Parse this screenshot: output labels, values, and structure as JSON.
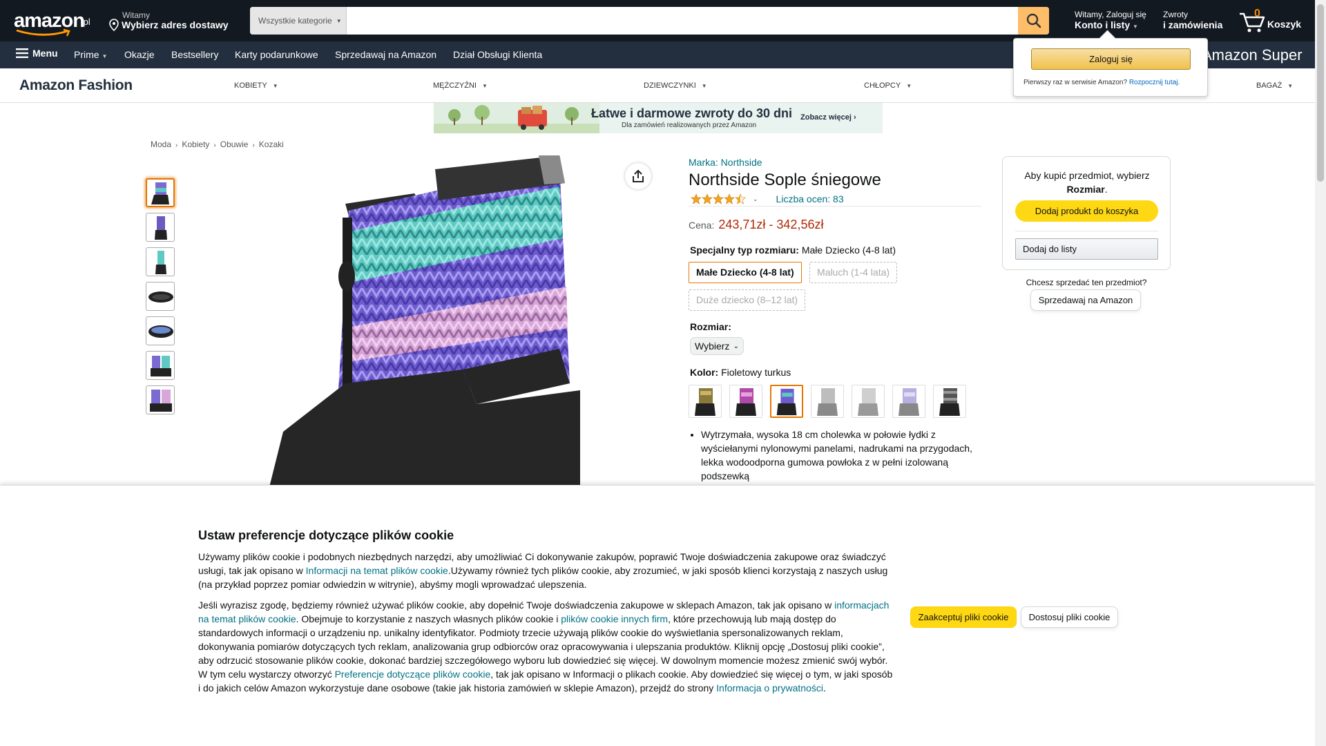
{
  "nav": {
    "logo_text": "amazon",
    "logo_tld": ".pl",
    "deliver_line1": "Witamy",
    "deliver_line2": "Wybierz adres dostawy",
    "search_category": "Wszystkie kategorie",
    "search_placeholder": "",
    "account_line1": "Witamy, Zaloguj się",
    "account_line2": "Konto i listy",
    "orders_line1": "Zwroty",
    "orders_line2": "i zamówienia",
    "cart_count": "0",
    "cart_label": "Koszyk",
    "accent_color": "#febd69"
  },
  "mainnav": {
    "menu": "Menu",
    "items": [
      "Prime",
      "Okazje",
      "Bestsellery",
      "Karty podarunkowe",
      "Sprzedawaj na Amazon",
      "Dział Obsługi Klienta"
    ],
    "promo": "Amazon Super"
  },
  "fashion": {
    "brand": "Amazon Fashion",
    "categories": [
      "KOBIETY",
      "MĘŻCZYŹNI",
      "DZIEWCZYNKI",
      "CHŁOPCY",
      "BAGAŻ"
    ]
  },
  "flyout": {
    "signin": "Zaloguj się",
    "new_customer": "Pierwszy raz w serwisie Amazon?",
    "start_link": "Rozpocznij tutaj."
  },
  "banner": {
    "title": "Łatwe i darmowe zwroty do 30 dni",
    "subtitle": "Dla zamówień realizowanych przez Amazon",
    "more": "Zobacz więcej ›"
  },
  "breadcrumb": [
    "Moda",
    "Kobiety",
    "Obuwie",
    "Kozaki"
  ],
  "product": {
    "brand": "Marka: Northside",
    "title": "Northside Sople śniegowe",
    "rating_stars": 4.5,
    "rating_count": "Liczba ocen: 83",
    "price_label": "Cena:",
    "price": "243,71zł - 342,56zł",
    "size_type_label": "Specjalny typ rozmiaru:",
    "size_type_value": "Małe Dziecko (4-8 lat)",
    "size_types": [
      {
        "label": "Małe Dziecko (4-8 lat)",
        "state": "selected"
      },
      {
        "label": "Maluch (1-4 lata)",
        "state": "unavailable"
      },
      {
        "label": "Duże dziecko (8–12 lat)",
        "state": "unavailable"
      }
    ],
    "size_label": "Rozmiar:",
    "size_select": "Wybierz",
    "color_label": "Kolor:",
    "color_value": "Fioletowy turkus",
    "swatch_count_selected_index": 2,
    "bullet1": "Wytrzymała, wysoka 18 cm cholewka w połowie łydki z wyściełanymi nylonowymi panelami, nadrukami na przygodach, lekka wodoodporna gumowa powłoka z w pełni izolowaną podszewką"
  },
  "buybox": {
    "msg_line1": "Aby kupić przedmiot, wybierz",
    "msg_bold": "Rozmiar",
    "msg_end": ".",
    "add_to_cart": "Dodaj produkt do koszyka",
    "add_to_list": "Dodaj do listy",
    "sell_question": "Chcesz sprzedać ten przedmiot?",
    "sell_button": "Sprzedawaj na Amazon"
  },
  "cookie": {
    "title": "Ustaw preferencje dotyczące plików cookie",
    "p1_a": "Używamy plików cookie i podobnych niezbędnych narzędzi, aby umożliwiać Ci dokonywanie zakupów, poprawić Twoje doświadczenia zakupowe oraz świadczyć usługi, tak jak opisano w ",
    "p1_link": "Informacji na temat plików cookie",
    "p1_b": ".Używamy również tych plików cookie, aby zrozumieć, w jaki sposób klienci korzystają z naszych usług (na przykład poprzez pomiar odwiedzin w witrynie), abyśmy mogli wprowadzać ulepszenia.",
    "p2_a": "Jeśli wyrazisz zgodę, będziemy również używać plików cookie, aby dopełnić Twoje doświadczenia zakupowe w sklepach Amazon, tak jak opisano w ",
    "p2_link1": "informacjach na temat plików cookie",
    "p2_b": ". Obejmuje to korzystanie z naszych własnych plików cookie i ",
    "p2_link2": "plików cookie innych firm",
    "p2_c": ", które przechowują lub mają dostęp do standardowych informacji o urządzeniu np. unikalny identyfikator. Podmioty trzecie używają plików cookie do wyświetlania spersonalizowanych reklam, dokonywania pomiarów dotyczących tych reklam, analizowania grup odbiorców oraz opracowywania i ulepszania produktów. Kliknij opcję „Dostosuj pliki cookie”, aby odrzucić stosowanie plików cookie, dokonać bardziej szczegółowego wyboru lub dowiedzieć się więcej. W dowolnym momencie możesz zmienić swój wybór. W tym celu wystarczy otworzyć ",
    "p2_link3": "Preferencje dotyczące plików cookie",
    "p2_d": ", tak jak opisano w Informacji o plikach cookie. Aby dowiedzieć się więcej o tym, w jaki sposób i do jakich celów Amazon wykorzystuje dane osobowe (takie jak historia zamówień w sklepie Amazon), przejdź do strony ",
    "p2_link4": "Informacja o prywatności",
    "p2_e": ".",
    "accept": "Zaakceptuj pliki cookie",
    "customize": "Dostosuj pliki cookie"
  },
  "icons": {
    "search": "search-icon",
    "cart": "cart-icon",
    "location": "location-pin-icon",
    "menu": "hamburger-icon",
    "share": "share-icon",
    "star": "star-icon"
  }
}
